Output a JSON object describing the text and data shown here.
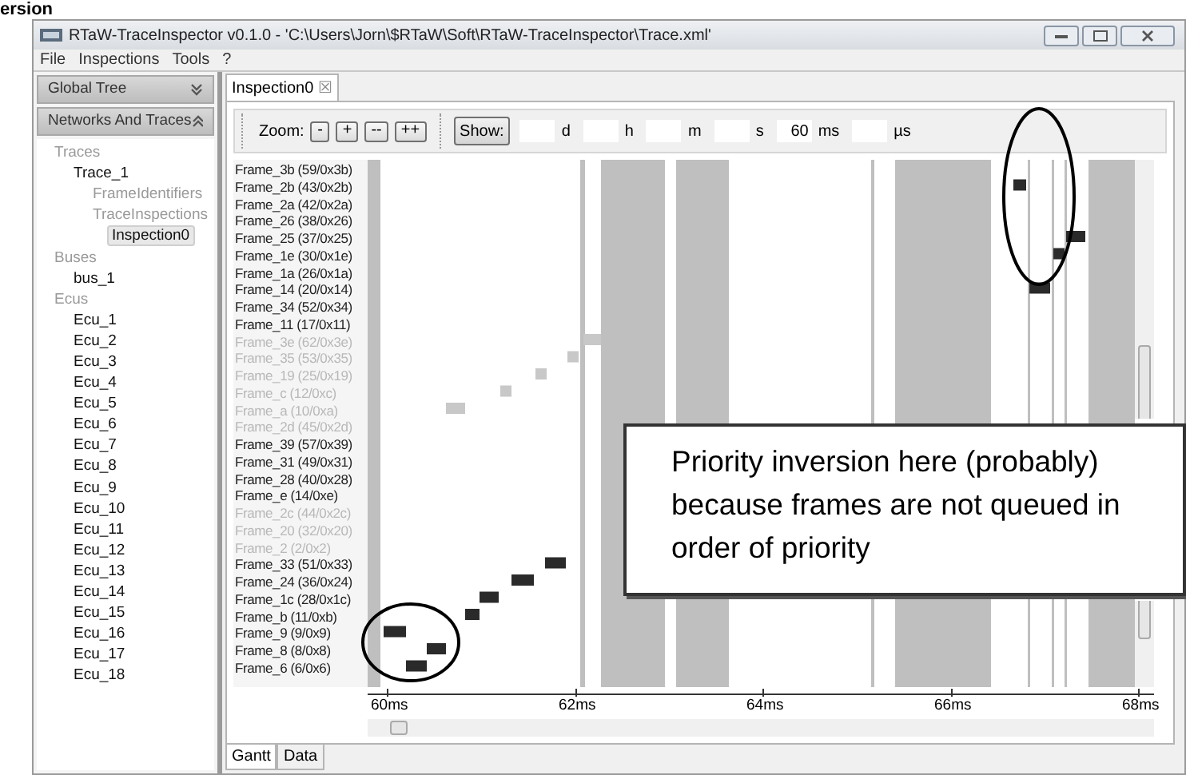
{
  "slide_heading": "ersion",
  "window": {
    "title": "RTaW-TraceInspector v0.1.0 - 'C:\\Users\\Jorn\\$RTaW\\Soft\\RTaW-TraceInspector\\Trace.xml'"
  },
  "menu": [
    "File",
    "Inspections",
    "Tools",
    "?"
  ],
  "sidebar": {
    "panels": [
      {
        "label": "Global Tree",
        "expanded": false
      },
      {
        "label": "Networks And Traces",
        "expanded": true
      }
    ],
    "tree": [
      {
        "label": "Traces",
        "kind": "group",
        "selected": false,
        "children": [
          {
            "label": "Trace_1",
            "kind": "item",
            "selected": false,
            "children": [
              {
                "label": "FrameIdentifiers",
                "kind": "group",
                "selected": false
              },
              {
                "label": "TraceInspections",
                "kind": "group",
                "selected": false,
                "children": [
                  {
                    "label": "Inspection0",
                    "kind": "item",
                    "selected": true
                  }
                ]
              }
            ]
          }
        ]
      },
      {
        "label": "Buses",
        "kind": "group",
        "selected": false,
        "children": [
          {
            "label": "bus_1",
            "kind": "item",
            "selected": false
          }
        ]
      },
      {
        "label": "Ecus",
        "kind": "group",
        "selected": false,
        "children": [
          {
            "label": "Ecu_1",
            "kind": "item",
            "selected": false
          },
          {
            "label": "Ecu_2",
            "kind": "item",
            "selected": false
          },
          {
            "label": "Ecu_3",
            "kind": "item",
            "selected": false
          },
          {
            "label": "Ecu_4",
            "kind": "item",
            "selected": false
          },
          {
            "label": "Ecu_5",
            "kind": "item",
            "selected": false
          },
          {
            "label": "Ecu_6",
            "kind": "item",
            "selected": false
          },
          {
            "label": "Ecu_7",
            "kind": "item",
            "selected": false
          },
          {
            "label": "Ecu_8",
            "kind": "item",
            "selected": false
          },
          {
            "label": "Ecu_9",
            "kind": "item",
            "selected": false
          },
          {
            "label": "Ecu_10",
            "kind": "item",
            "selected": false
          },
          {
            "label": "Ecu_11",
            "kind": "item",
            "selected": false
          },
          {
            "label": "Ecu_12",
            "kind": "item",
            "selected": false
          },
          {
            "label": "Ecu_13",
            "kind": "item",
            "selected": false
          },
          {
            "label": "Ecu_14",
            "kind": "item",
            "selected": false
          },
          {
            "label": "Ecu_15",
            "kind": "item",
            "selected": false
          },
          {
            "label": "Ecu_16",
            "kind": "item",
            "selected": false
          },
          {
            "label": "Ecu_17",
            "kind": "item",
            "selected": false
          },
          {
            "label": "Ecu_18",
            "kind": "item",
            "selected": false
          }
        ]
      }
    ]
  },
  "editor_tab": {
    "label": "Inspection0",
    "close": "☒"
  },
  "toolbar": {
    "zoom_label": "Zoom:",
    "zoom_buttons": [
      "-",
      "+",
      "--",
      "++"
    ],
    "show_button": "Show:",
    "time_fields": [
      {
        "unit": "d"
      },
      {
        "unit": "h"
      },
      {
        "unit": "m"
      },
      {
        "unit": "s"
      },
      {
        "value": "60",
        "unit": "ms"
      },
      {
        "unit": "µs"
      }
    ]
  },
  "frames": [
    {
      "label": "Frame_3b (59/0x3b)",
      "dimmed": false
    },
    {
      "label": "Frame_2b (43/0x2b)",
      "dimmed": false
    },
    {
      "label": "Frame_2a (42/0x2a)",
      "dimmed": false
    },
    {
      "label": "Frame_26 (38/0x26)",
      "dimmed": false
    },
    {
      "label": "Frame_25 (37/0x25)",
      "dimmed": false
    },
    {
      "label": "Frame_1e (30/0x1e)",
      "dimmed": false
    },
    {
      "label": "Frame_1a (26/0x1a)",
      "dimmed": false
    },
    {
      "label": "Frame_14 (20/0x14)",
      "dimmed": false
    },
    {
      "label": "Frame_34 (52/0x34)",
      "dimmed": false
    },
    {
      "label": "Frame_11 (17/0x11)",
      "dimmed": false
    },
    {
      "label": "Frame_3e (62/0x3e)",
      "dimmed": true
    },
    {
      "label": "Frame_35 (53/0x35)",
      "dimmed": true
    },
    {
      "label": "Frame_19 (25/0x19)",
      "dimmed": true
    },
    {
      "label": "Frame_c (12/0xc)",
      "dimmed": true
    },
    {
      "label": "Frame_a (10/0xa)",
      "dimmed": true
    },
    {
      "label": "Frame_2d (45/0x2d)",
      "dimmed": true
    },
    {
      "label": "Frame_39 (57/0x39)",
      "dimmed": false
    },
    {
      "label": "Frame_31 (49/0x31)",
      "dimmed": false
    },
    {
      "label": "Frame_28 (40/0x28)",
      "dimmed": false
    },
    {
      "label": "Frame_e (14/0xe)",
      "dimmed": false
    },
    {
      "label": "Frame_2c (44/0x2c)",
      "dimmed": true
    },
    {
      "label": "Frame_20 (32/0x20)",
      "dimmed": true
    },
    {
      "label": "Frame_2 (2/0x2)",
      "dimmed": true
    },
    {
      "label": "Frame_33 (51/0x33)",
      "dimmed": false
    },
    {
      "label": "Frame_24 (36/0x24)",
      "dimmed": false
    },
    {
      "label": "Frame_1c (28/0x1c)",
      "dimmed": false
    },
    {
      "label": "Frame_b (11/0xb)",
      "dimmed": false
    },
    {
      "label": "Frame_9 (9/0x9)",
      "dimmed": false
    },
    {
      "label": "Frame_8 (8/0x8)",
      "dimmed": false
    },
    {
      "label": "Frame_6 (6/0x6)",
      "dimmed": false
    }
  ],
  "time_axis": [
    "60ms",
    "62ms",
    "64ms",
    "66ms",
    "68ms"
  ],
  "bottom_tabs": [
    {
      "label": "Gantt",
      "selected": true
    },
    {
      "label": "Data",
      "selected": false
    }
  ],
  "annotation": {
    "text": "Priority inversion here (probably) because frames are not queued in order of priority"
  }
}
